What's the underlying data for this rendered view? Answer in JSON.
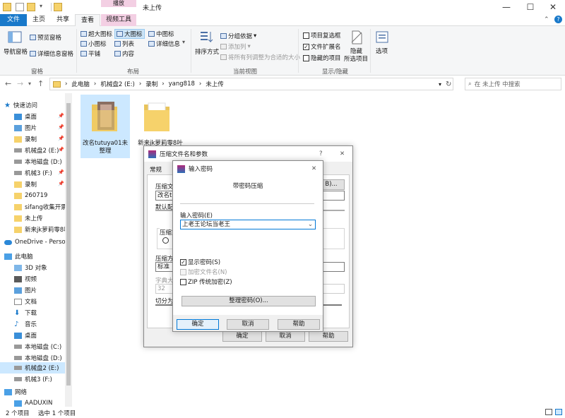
{
  "window": {
    "title": "未上传",
    "context_tab": "播放"
  },
  "tabs": [
    {
      "label": "文件"
    },
    {
      "label": "主页"
    },
    {
      "label": "共享"
    },
    {
      "label": "查看"
    },
    {
      "label": "视频工具"
    }
  ],
  "ribbon": {
    "panes": {
      "nav_pane": "导航窗格",
      "preview_pane": "预览窗格",
      "details_pane": "详细信息窗格",
      "group": "窗格"
    },
    "layout": {
      "xl_icons": "超大图标",
      "large_icons": "大图标",
      "medium_icons": "中图标",
      "small_icons": "小图标",
      "list": "列表",
      "details": "详细信息",
      "tiles": "平铺",
      "content": "内容",
      "group": "布局"
    },
    "current_view": {
      "sort": "排序方式",
      "group_by": "分组依据",
      "add_column": "添加列",
      "fit_columns": "将所有列调整为合适的大小",
      "group": "当前视图"
    },
    "show_hide": {
      "item_checkboxes": "项目复选框",
      "item_checkboxes_checked": false,
      "file_extensions": "文件扩展名",
      "file_extensions_checked": true,
      "hidden_items": "隐藏的项目",
      "hidden_items_checked": false,
      "hide_selected_1": "隐藏",
      "hide_selected_2": "所选项目",
      "group": "显示/隐藏"
    },
    "options": "选项"
  },
  "address": {
    "crumbs": [
      "此电脑",
      "机械盘2 (E:)",
      "录制",
      "yang818",
      "未上传"
    ],
    "search_placeholder": "在 未上传 中搜索"
  },
  "nav": {
    "items": [
      {
        "label": "快速访问"
      },
      {
        "label": "桌面"
      },
      {
        "label": "图片"
      },
      {
        "label": "录制"
      },
      {
        "label": "机械盘2 (E:)"
      },
      {
        "label": "本地磁盘 (D:)"
      },
      {
        "label": "机械3 (F:)"
      },
      {
        "label": "录制"
      },
      {
        "label": "260719"
      },
      {
        "label": "sifang收集开票"
      },
      {
        "label": "未上传"
      },
      {
        "label": "新来jk萝莉零8叶"
      },
      {
        "label": "OneDrive - Perso"
      },
      {
        "label": "此电脑"
      },
      {
        "label": "3D 对象"
      },
      {
        "label": "视频"
      },
      {
        "label": "图片"
      },
      {
        "label": "文档"
      },
      {
        "label": "下载"
      },
      {
        "label": "音乐"
      },
      {
        "label": "桌面"
      },
      {
        "label": "本地磁盘 (C:)"
      },
      {
        "label": "本地磁盘 (D:)"
      },
      {
        "label": "机械盘2 (E:)"
      },
      {
        "label": "机械3 (F:)"
      },
      {
        "label": "网络"
      },
      {
        "label": "AADUXIN"
      }
    ]
  },
  "files": [
    {
      "label_1": "改名tutuya01未",
      "label_2": "整理"
    },
    {
      "label_1": "新来jk萝莉零8叶"
    }
  ],
  "status": {
    "count": "2 个项目",
    "selected": "选中 1 个项目"
  },
  "compress_dialog": {
    "title": "压缩文件名和参数",
    "help_btn": "?",
    "tab_general": "常规",
    "frag_archive_name": "压缩文",
    "frag_name_value": "改名tu",
    "frag_browse": "B)...",
    "frag_default": "默认配",
    "frag_format": "压缩文",
    "frag_method": "压缩方",
    "frag_method_value": "标准",
    "frag_dict": "字典大",
    "frag_dict_value": "32",
    "frag_split": "切分为",
    "ok": "确定",
    "cancel": "取消",
    "help": "帮助"
  },
  "password_dialog": {
    "title": "输入密码",
    "heading": "带密码压缩",
    "label": "输入密码(E)",
    "value": "上老王论坛当老王",
    "show_password": "显示密码(S)",
    "show_password_checked": true,
    "encrypt_names": "加密文件名(N)",
    "zip_legacy": "ZIP 传统加密(Z)",
    "organize": "整理密码(O)...",
    "ok": "确定",
    "cancel": "取消",
    "help": "帮助"
  }
}
